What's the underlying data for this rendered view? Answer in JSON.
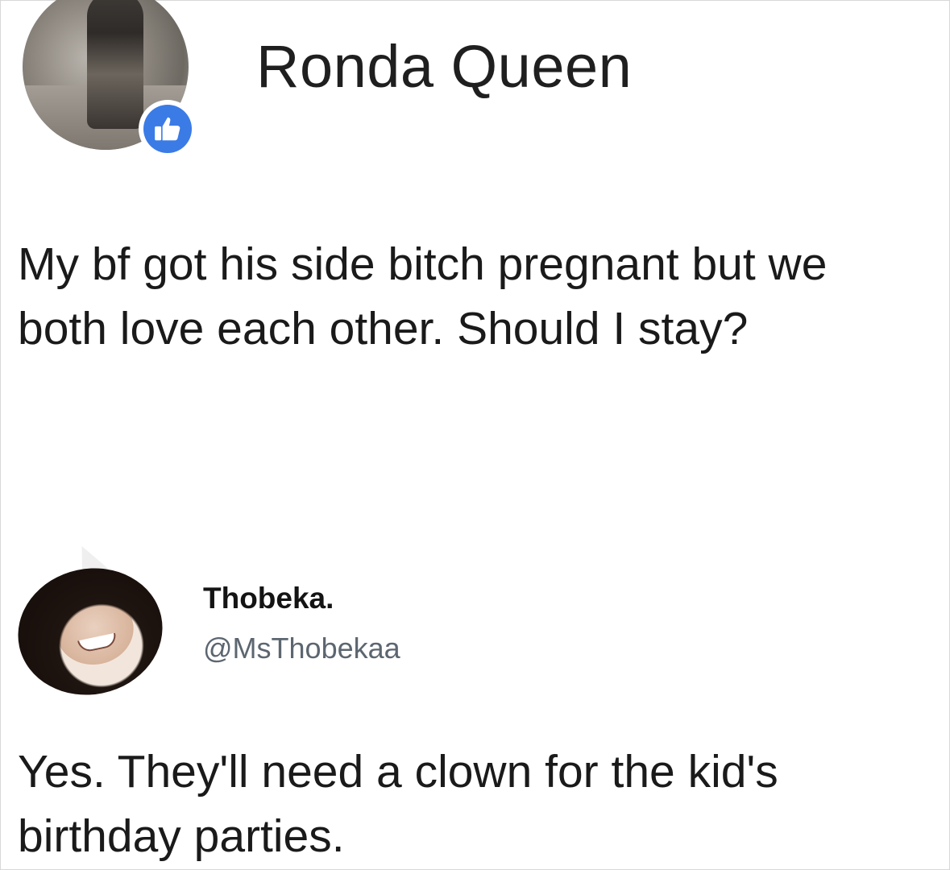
{
  "post": {
    "author_name": "Ronda Queen",
    "avatar_badge_icon": "thumbs-up-icon",
    "badge_color": "#3b7be6",
    "text_line1": "My bf got his side bitch pregnant but we",
    "text_line2": "both love each other. Should I stay?"
  },
  "reply": {
    "display_name": "Thobeka.",
    "handle": "@MsThobekaa",
    "handle_color": "#5c6670",
    "text_line1": "Yes. They'll need a clown for the kid's",
    "text_line2": "birthday parties."
  }
}
